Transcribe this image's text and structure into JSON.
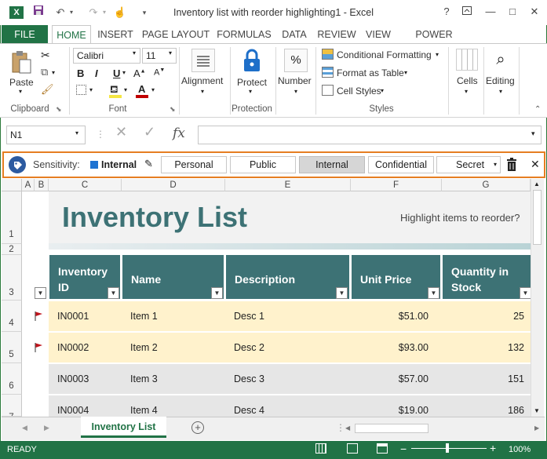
{
  "window": {
    "title": "Inventory list with reorder highlighting1 - Excel"
  },
  "ribbon": {
    "tabs": [
      "FILE",
      "HOME",
      "INSERT",
      "PAGE LAYOUT",
      "FORMULAS",
      "DATA",
      "REVIEW",
      "VIEW",
      "POWER QUERY"
    ],
    "active_tab": "HOME",
    "clipboard": {
      "paste": "Paste",
      "label": "Clipboard"
    },
    "font": {
      "name": "Calibri",
      "size": "11",
      "bold": "B",
      "italic": "I",
      "underline": "U",
      "label": "Font",
      "fill_color": "#f5e642",
      "font_color": "#c00000"
    },
    "alignment": {
      "label": "Alignment"
    },
    "protection": {
      "button": "Protect",
      "label": "Protection"
    },
    "number": {
      "button": "Number",
      "symbol": "%"
    },
    "styles": {
      "conditional": "Conditional Formatting",
      "format_table": "Format as Table",
      "cell_styles": "Cell Styles",
      "label": "Styles"
    },
    "cells": {
      "button": "Cells"
    },
    "editing": {
      "button": "Editing"
    }
  },
  "formula_bar": {
    "name_box": "N1",
    "fx": "fx",
    "value": ""
  },
  "sensitivity": {
    "label": "Sensitivity:",
    "current": "Internal",
    "current_color": "#1e73d2",
    "options": [
      "Personal",
      "Public",
      "Internal",
      "Confidential"
    ],
    "dropdown": "Secret",
    "selected": "Internal"
  },
  "grid": {
    "columns": [
      "A",
      "B",
      "C",
      "D",
      "E",
      "F",
      "G"
    ],
    "rows": [
      "1",
      "2",
      "3",
      "4",
      "5",
      "6",
      "7"
    ],
    "title": "Inventory List",
    "subtitle": "Highlight items to reorder?",
    "headers": [
      "Inventory ID",
      "Name",
      "Description",
      "Unit Price",
      "Quantity in Stock"
    ],
    "items": [
      {
        "id": "IN0001",
        "name": "Item 1",
        "desc": "Desc 1",
        "price": "$51.00",
        "qty": "25",
        "flag": true,
        "highlight": true
      },
      {
        "id": "IN0002",
        "name": "Item 2",
        "desc": "Desc 2",
        "price": "$93.00",
        "qty": "132",
        "flag": true,
        "highlight": true
      },
      {
        "id": "IN0003",
        "name": "Item 3",
        "desc": "Desc 3",
        "price": "$57.00",
        "qty": "151",
        "flag": false,
        "highlight": false
      },
      {
        "id": "IN0004",
        "name": "Item 4",
        "desc": "Desc 4",
        "price": "$19.00",
        "qty": "186",
        "flag": false,
        "highlight": false
      }
    ]
  },
  "sheets": {
    "active": "Inventory List"
  },
  "status": {
    "ready": "READY",
    "zoom": "100%"
  },
  "colors": {
    "excel_green": "#217346",
    "header_teal": "#3d7275",
    "highlight_row": "#fff2cc",
    "plain_row": "#e6e6e6",
    "title_teal": "#3d7275"
  }
}
